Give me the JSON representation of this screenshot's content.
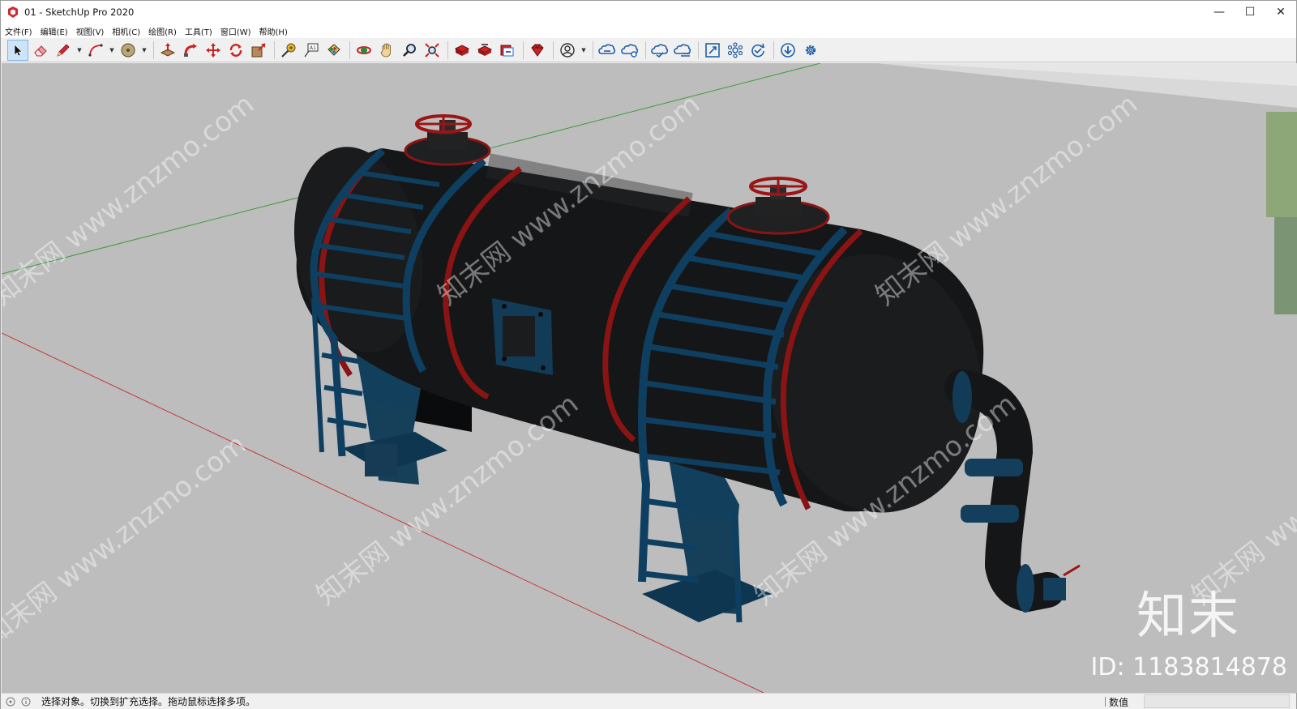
{
  "window": {
    "title": "01 - SketchUp Pro 2020",
    "minimize_glyph": "—",
    "maximize_glyph": "☐",
    "close_glyph": "✕"
  },
  "menu": {
    "items": [
      {
        "label": "文件(F)"
      },
      {
        "label": "编辑(E)"
      },
      {
        "label": "视图(V)"
      },
      {
        "label": "相机(C)"
      },
      {
        "label": "绘图(R)"
      },
      {
        "label": "工具(T)"
      },
      {
        "label": "窗口(W)"
      },
      {
        "label": "帮助(H)"
      }
    ]
  },
  "toolbar": {
    "tools": [
      {
        "name": "select-tool",
        "icon": "arrow-cursor-icon",
        "active": true
      },
      {
        "name": "eraser-tool",
        "icon": "eraser-icon"
      },
      {
        "name": "line-tool",
        "icon": "pencil-icon"
      },
      {
        "name": "arc-tool",
        "icon": "arc-icon"
      },
      {
        "name": "shapes-tool",
        "icon": "circle-shape-icon"
      },
      {
        "name": "push-pull-tool",
        "icon": "push-pull-icon"
      },
      {
        "name": "follow-me-tool",
        "icon": "follow-me-icon"
      },
      {
        "name": "move-tool",
        "icon": "move-arrows-icon"
      },
      {
        "name": "rotate-tool",
        "icon": "rotate-icon"
      },
      {
        "name": "scale-tool",
        "icon": "scale-icon"
      },
      {
        "name": "tape-measure-tool",
        "icon": "tape-measure-icon"
      },
      {
        "name": "text-tool",
        "icon": "text-icon"
      },
      {
        "name": "paint-bucket-tool",
        "icon": "paint-bucket-icon"
      },
      {
        "name": "orbit-tool",
        "icon": "orbit-icon"
      },
      {
        "name": "pan-tool",
        "icon": "hand-icon"
      },
      {
        "name": "zoom-tool",
        "icon": "magnifier-icon"
      },
      {
        "name": "zoom-extents-tool",
        "icon": "zoom-extents-icon"
      },
      {
        "name": "3d-warehouse",
        "icon": "warehouse-icon"
      },
      {
        "name": "extension-warehouse",
        "icon": "extension-warehouse-icon"
      },
      {
        "name": "send-to-layout",
        "icon": "layout-icon"
      },
      {
        "name": "extension-manager",
        "icon": "ruby-gem-icon"
      },
      {
        "name": "account",
        "icon": "user-profile-icon"
      },
      {
        "name": "trimble-connect-1",
        "icon": "cloud-link-icon"
      },
      {
        "name": "trimble-connect-2",
        "icon": "cloud-share-icon"
      },
      {
        "name": "trimble-connect-3",
        "icon": "cloud-check-icon"
      },
      {
        "name": "trimble-connect-4",
        "icon": "cloud-lines-icon"
      },
      {
        "name": "plugin-resize",
        "icon": "resize-box-icon"
      },
      {
        "name": "plugin-network",
        "icon": "network-icon"
      },
      {
        "name": "plugin-sync",
        "icon": "sync-check-icon"
      },
      {
        "name": "plugin-download",
        "icon": "download-circle-icon"
      },
      {
        "name": "plugin-settings",
        "icon": "gear-icon"
      }
    ]
  },
  "viewport": {
    "watermark_brand": "知末",
    "watermark_id": "ID: 1183814878",
    "tile_watermark": "知末网 www.znzmo.com",
    "colors": {
      "ground": "#bdbdbd",
      "tank": "#151617",
      "frame": "#0d3a55",
      "band": "#8a1414",
      "green_axis": "#3e9a3e",
      "red_axis": "#c23a3a"
    }
  },
  "statusbar": {
    "hint": "选择对象。切换到扩充选择。拖动鼠标选择多项。",
    "measurements_label": "数值",
    "measurements_value": ""
  }
}
